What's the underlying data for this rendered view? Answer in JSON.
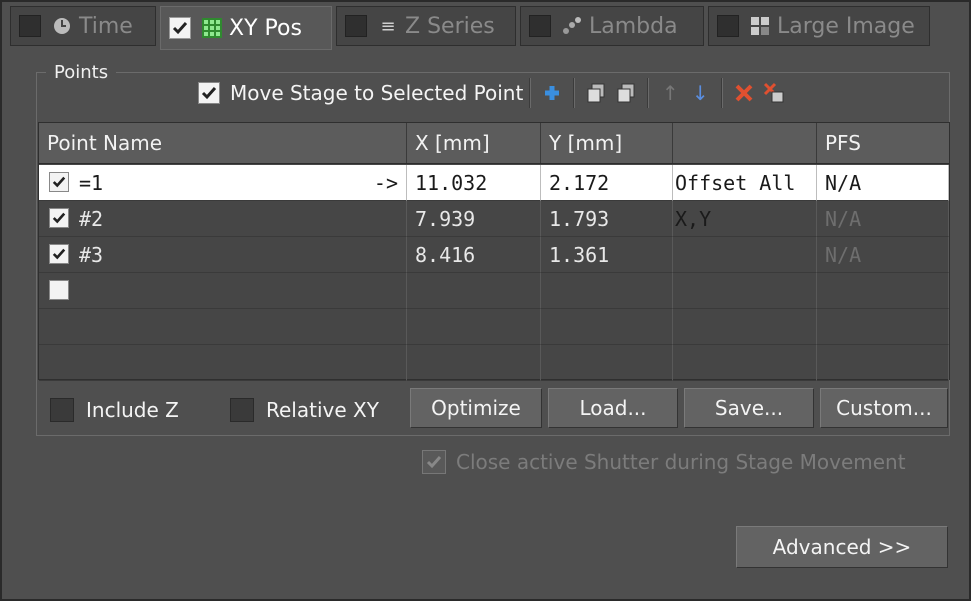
{
  "tabs": [
    {
      "label": "Time",
      "icon": "clock-icon",
      "checked": false
    },
    {
      "label": "XY Pos",
      "icon": "grid-icon",
      "checked": true
    },
    {
      "label": "Z Series",
      "icon": "stack-icon",
      "checked": false
    },
    {
      "label": "Lambda",
      "icon": "lambda-icon",
      "checked": false
    },
    {
      "label": "Large Image",
      "icon": "tiles-icon",
      "checked": false
    }
  ],
  "points": {
    "group_label": "Points",
    "move_stage_label": "Move Stage to Selected Point"
  },
  "table": {
    "headers": [
      "Point Name",
      "X [mm]",
      "Y [mm]",
      "",
      "PFS"
    ],
    "rows": [
      {
        "checked": true,
        "name": "=1",
        "arrow": "->",
        "x": "11.032",
        "y": "2.172",
        "extra": "Offset All X,Y",
        "pfs": "N/A",
        "selected": true
      },
      {
        "checked": true,
        "name": "#2",
        "arrow": "",
        "x": "7.939",
        "y": "1.793",
        "extra": "",
        "pfs": "N/A",
        "selected": false
      },
      {
        "checked": true,
        "name": "#3",
        "arrow": "",
        "x": "8.416",
        "y": "1.361",
        "extra": "",
        "pfs": "N/A",
        "selected": false
      },
      {
        "checked": false,
        "name": "",
        "arrow": "",
        "x": "",
        "y": "",
        "extra": "",
        "pfs": "",
        "selected": false
      }
    ]
  },
  "options": {
    "include_z": "Include Z",
    "relative_xy": "Relative XY"
  },
  "buttons": {
    "optimize": "Optimize",
    "load": "Load...",
    "save": "Save...",
    "custom": "Custom...",
    "advanced": "Advanced >>"
  },
  "shutter_label": "Close active Shutter during Stage Movement",
  "colors": {
    "background": "#4f4f4f",
    "selected_row": "#ffffff",
    "add_icon": "#3a8fe0",
    "delete_icon": "#e05030"
  }
}
